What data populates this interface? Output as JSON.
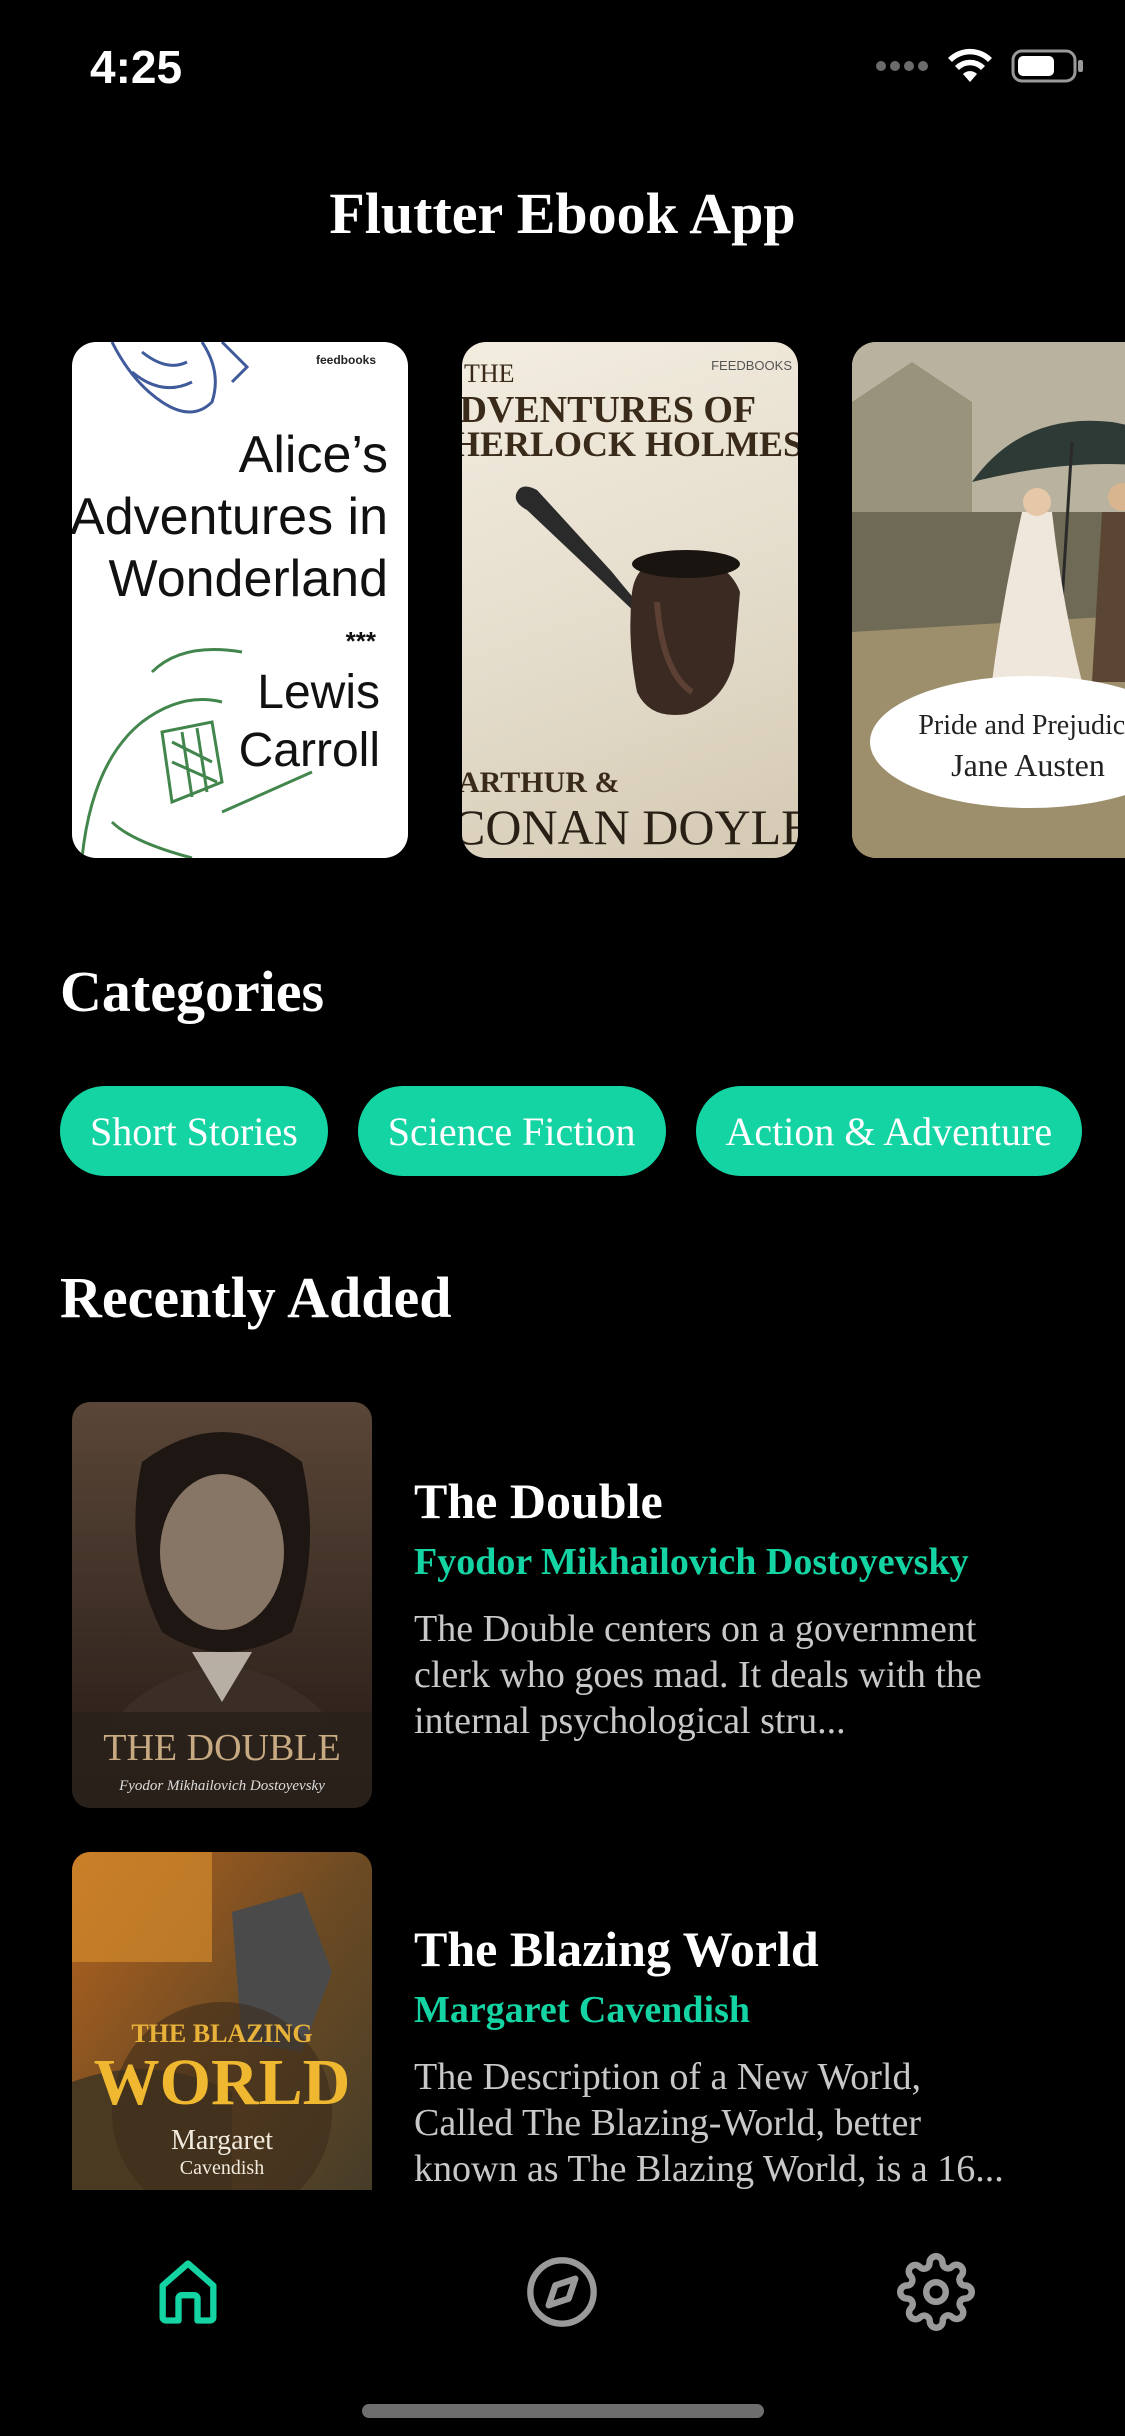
{
  "status_bar": {
    "time": "4:25"
  },
  "header": {
    "title": "Flutter Ebook App"
  },
  "featured": {
    "books": [
      {
        "title_lines": [
          "Alice’s",
          "Adventures in",
          "Wonderland"
        ],
        "stars": "***",
        "author_lines": [
          "Lewis",
          "Carroll"
        ],
        "publisher": "feedbooks"
      },
      {
        "title_lines": [
          "THE",
          "ADVENTURES OF",
          "SHERLOCK HOLMES"
        ],
        "author_lines": [
          "ARTHUR &",
          "CONAN DOYLE"
        ],
        "publisher": "FEEDBOOKS"
      },
      {
        "title": "Pride and Prejudice",
        "author": "Jane Austen"
      }
    ]
  },
  "categories": {
    "title": "Categories",
    "items": [
      "Short Stories",
      "Science Fiction",
      "Action & Adventure"
    ]
  },
  "recent": {
    "title": "Recently Added",
    "books": [
      {
        "title": "The Double",
        "author": "Fyodor Mikhailovich Dostoyevsky",
        "description_lines": [
          "The Double centers on a government",
          "clerk who goes mad. It deals with the",
          "internal psychological stru..."
        ],
        "cover_title": "THE DOUBLE",
        "cover_author": "Fyodor Mikhailovich Dostoyevsky"
      },
      {
        "title": "The Blazing World",
        "author": "Margaret Cavendish",
        "description_lines": [
          "The Description of a New World,",
          "Called The Blazing-World, better",
          "known as The Blazing World, is a 16..."
        ],
        "cover_title_small": "THE BLAZING",
        "cover_title_big": "WORLD",
        "cover_author_lines": [
          "Margaret",
          "Cavendish"
        ]
      }
    ]
  },
  "nav": {
    "items": [
      {
        "icon": "home-icon",
        "active": true
      },
      {
        "icon": "compass-icon",
        "active": false
      },
      {
        "icon": "gear-icon",
        "active": false
      }
    ]
  },
  "colors": {
    "accent": "#14d4a4",
    "background": "#000000",
    "inactive": "#9a9a9a"
  }
}
